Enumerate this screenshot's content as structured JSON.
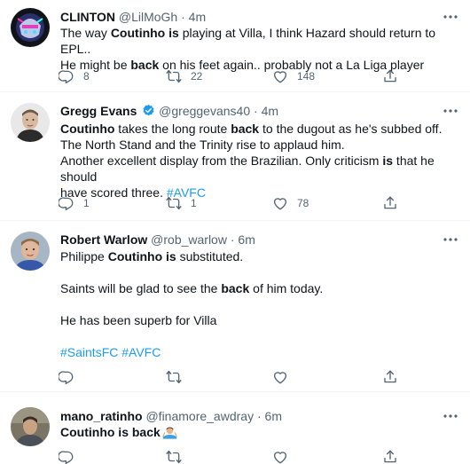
{
  "tweets": [
    {
      "name": "CLINTON",
      "handle": "@LilMoGh",
      "dot": "·",
      "time": "4m",
      "text": {
        "p1": "The way ",
        "b1": "Coutinho is",
        "p2": " playing at Villa, I think Hazard should return to EPL..",
        "p3": "He might be ",
        "b2": "back",
        "p4": " on his feet again.. probably not a La Liga player"
      },
      "replies": "8",
      "retweets": "22",
      "likes": "148"
    },
    {
      "name": "Gregg Evans",
      "handle": "@greggevans40",
      "dot": "·",
      "time": "4m",
      "text": {
        "b1": "Coutinho",
        "p1": " takes the long route ",
        "b2": "back",
        "p2": " to the dugout as he's subbed off.",
        "line2": "The North Stand and the Trinity rise to applaud him.",
        "p3": "Another excellent display from the Brazilian. Only criticism ",
        "b3": "is",
        "p4": " that he should",
        "p5": "have scored three. ",
        "hashtag": "#AVFC"
      },
      "replies": "1",
      "retweets": "1",
      "likes": "78"
    },
    {
      "name": "Robert Warlow",
      "handle": "@rob_warlow",
      "dot": "·",
      "time": "6m",
      "text": {
        "p1": "Philippe ",
        "b1": "Coutinho is",
        "p2": " substituted.",
        "p3": "Saints will be glad to see the ",
        "b2": "back",
        "p4": " of him today.",
        "line3": "He has been superb for Villa",
        "hashtags": "#SaintsFC #AVFC"
      },
      "replies": "",
      "retweets": "",
      "likes": ""
    },
    {
      "name": "mano_ratinho",
      "handle": "@finamore_awdray",
      "dot": "·",
      "time": "6m",
      "text": {
        "b1": "Coutinho is back"
      },
      "replies": "",
      "retweets": "",
      "likes": ""
    }
  ],
  "colors": {
    "text": "#0f1419",
    "secondary": "#536471",
    "link": "#1d9bf0",
    "divider": "#eff3f4",
    "verified": "#1d9bf0"
  },
  "icons": [
    "reply-icon",
    "retweet-icon",
    "like-icon",
    "share-icon",
    "more-icon",
    "verified-badge-icon"
  ]
}
